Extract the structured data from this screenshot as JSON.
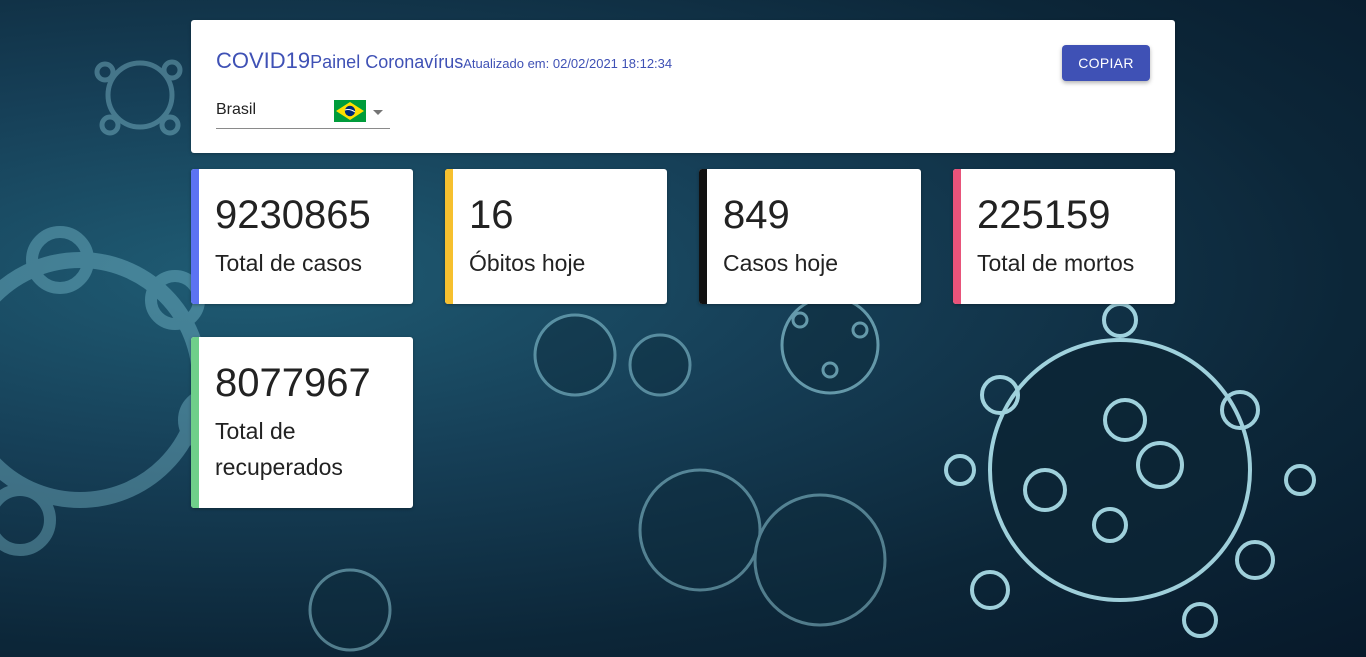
{
  "header": {
    "title": "COVID19",
    "subtitle": "Painel Coronavírus",
    "updated": "Atualizado em: 02/02/2021 18:12:34",
    "copy_label": "COPIAR"
  },
  "country": {
    "selected": "Brasil",
    "flag_icon": "brazil-flag-icon"
  },
  "stats": [
    {
      "value": "9230865",
      "label": "Total de casos",
      "color": "#5c73f2"
    },
    {
      "value": "16",
      "label": "Óbitos hoje",
      "color": "#f6c02f"
    },
    {
      "value": "849",
      "label": "Casos hoje",
      "color": "#111111"
    },
    {
      "value": "225159",
      "label": "Total de mortos",
      "color": "#e8537a"
    },
    {
      "value": "8077967",
      "label": "Total de recuperados",
      "color": "#6fcf8a"
    }
  ]
}
